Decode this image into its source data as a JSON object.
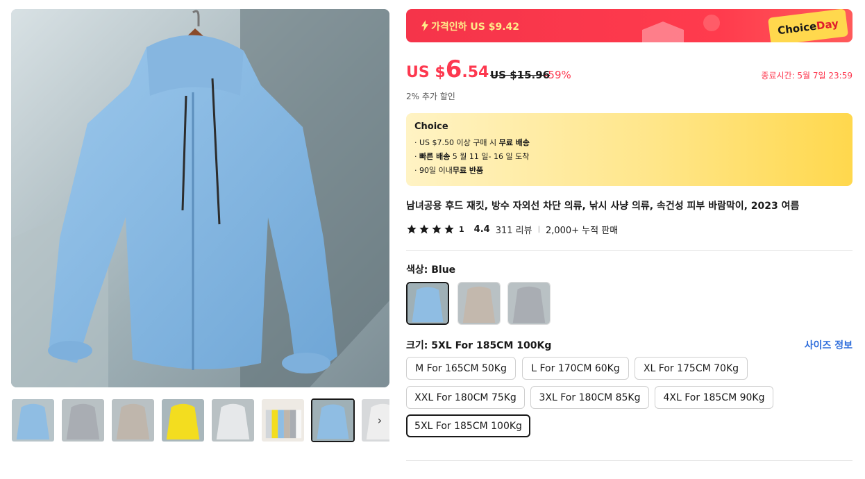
{
  "gallery": {
    "main_image": "blue-hooded-jacket-photo",
    "thumbnails": [
      {
        "color": "#8fbde3",
        "desc": "blue"
      },
      {
        "color": "#a9adb3",
        "desc": "grey"
      },
      {
        "color": "#bfb6ac",
        "desc": "khaki"
      },
      {
        "color": "#f3dd1f",
        "desc": "yellow"
      },
      {
        "color": "#e6e8ea",
        "desc": "white"
      },
      {
        "color": "#d7c9a6",
        "desc": "all-colors"
      },
      {
        "color": "#8fbde3",
        "desc": "blue-selected"
      },
      {
        "color": "#e8e8e8",
        "desc": "partial"
      }
    ],
    "next_arrow": "›"
  },
  "promo": {
    "text": "가격인하 US $9.42",
    "tag_choice": "Choice",
    "tag_day": "Day"
  },
  "price": {
    "currency": "US $",
    "integer": "6",
    "decimal": ".54",
    "original": "US $15.96",
    "discount": "-59%",
    "end_time": "종료시간: 5월 7일 23:59",
    "extra_discount": "2% 추가 할인"
  },
  "choice": {
    "title": "Choice",
    "line1_pre": "US $7.50 이상 구매 시 ",
    "line1_bold": "무료 배송",
    "line2_bold": "빠른 배송",
    "line2_post": " 5 월 11 일- 16 일 도착",
    "line3_pre": "90일 이내",
    "line3_bold": "무료 반품"
  },
  "product": {
    "title": "남녀공용 후드 재킷, 방수 자외선 차단 의류, 낚시 사냥 의류, 속건성 피부 바람막이, 2023 여름",
    "star_count_label": "1",
    "rating": "4.4",
    "reviews": "311 리뷰",
    "separator": "|",
    "sold": "2,000+ 누적 판매"
  },
  "color": {
    "label": "색상: Blue",
    "swatches": [
      "#8fbde3",
      "#c3b8ad",
      "#a9adb3"
    ]
  },
  "size": {
    "label": "크기: 5XL For 185CM 100Kg",
    "guide": "사이즈 정보",
    "options": [
      "M For 165CM 50Kg",
      "L For 170CM 60Kg",
      "XL For 175CM 70Kg",
      "XXL For 180CM 75Kg",
      "3XL For 180CM 85Kg",
      "4XL For 185CM 90Kg",
      "5XL For 185CM 100Kg"
    ],
    "selected": "5XL For 185CM 100Kg"
  },
  "colors": {
    "accent": "#fd384f",
    "link": "#2e6ddb",
    "choice_yellow": "#ffd84d"
  }
}
